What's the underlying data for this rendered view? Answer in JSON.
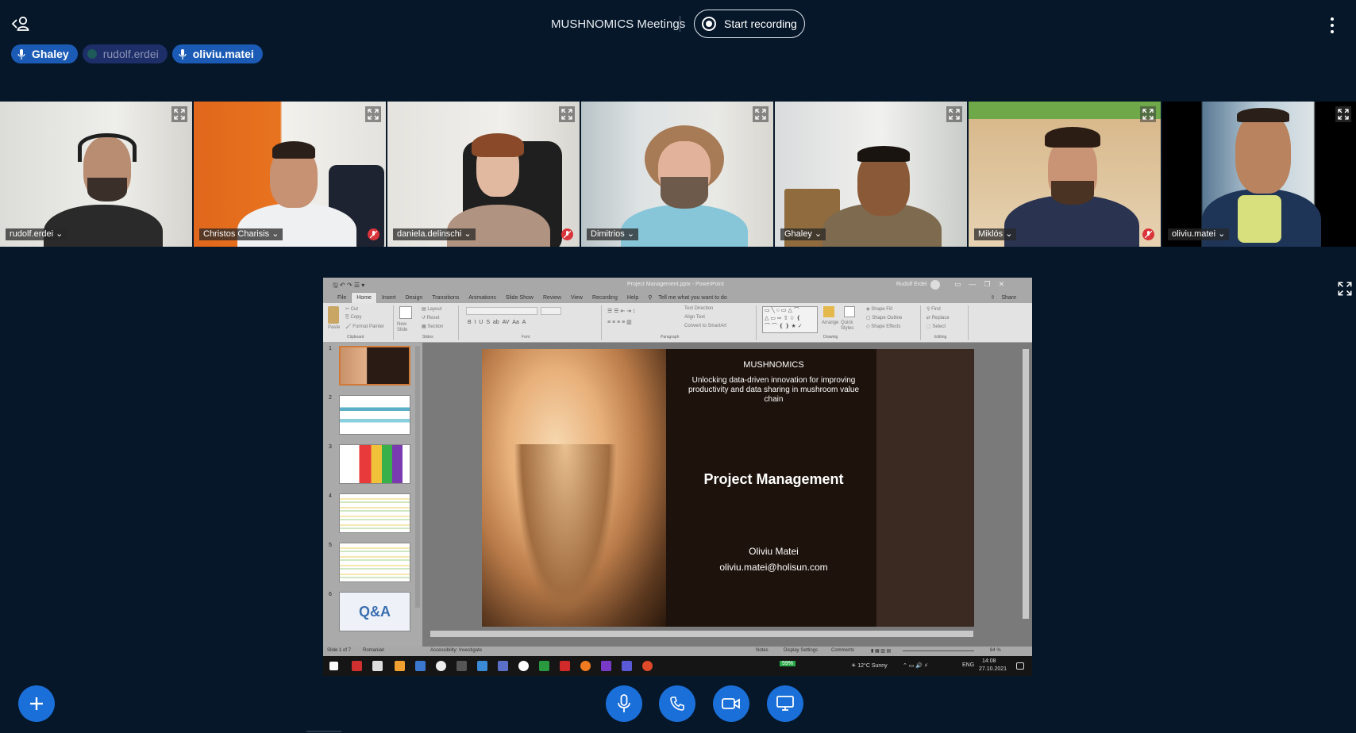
{
  "meeting": {
    "title": "MUSHNOMICS Meetings",
    "record_label": "Start recording"
  },
  "talkers": [
    {
      "name": "Ghaley",
      "state": "talking"
    },
    {
      "name": "rudolf.erdei",
      "state": "muted"
    },
    {
      "name": "oliviu.matei",
      "state": "talking"
    }
  ],
  "participants": [
    {
      "name": "rudolf.erdei",
      "muted": false,
      "speaking": false
    },
    {
      "name": "Christos Charisis",
      "muted": true,
      "speaking": false
    },
    {
      "name": "daniela.delinschi",
      "muted": true,
      "speaking": false
    },
    {
      "name": "Dimitrios",
      "muted": false,
      "speaking": false
    },
    {
      "name": "Ghaley",
      "muted": false,
      "speaking": true
    },
    {
      "name": "Miklós",
      "muted": true,
      "speaking": false
    },
    {
      "name": "oliviu.matei",
      "muted": false,
      "speaking": true
    }
  ],
  "powerpoint": {
    "window_title": "Project Management.pptx - PowerPoint",
    "user": "Rudolf Erdei",
    "tabs": [
      "File",
      "Home",
      "Insert",
      "Design",
      "Transitions",
      "Animations",
      "Slide Show",
      "Review",
      "View",
      "Recording",
      "Help"
    ],
    "active_tab": "Home",
    "tell_me": "Tell me what you want to do",
    "share": "Share",
    "ribbon_groups": [
      "Clipboard",
      "Slides",
      "Font",
      "Paragraph",
      "Drawing",
      "Editing"
    ],
    "ribbon_items": {
      "paste": "Paste",
      "cut": "Cut",
      "copy": "Copy",
      "format_painter": "Format Painter",
      "new_slide": "New Slide",
      "layout": "Layout",
      "reset": "Reset",
      "section": "Section",
      "text_direction": "Text Direction",
      "align_text": "Align Text",
      "convert_smartart": "Convert to SmartArt",
      "arrange": "Arrange",
      "quick_styles": "Quick Styles",
      "shape_fill": "Shape Fill",
      "shape_outline": "Shape Outline",
      "shape_effects": "Shape Effects",
      "find": "Find",
      "replace": "Replace",
      "select": "Select"
    },
    "slide_numbers": [
      "1",
      "2",
      "3",
      "4",
      "5",
      "6"
    ],
    "slide": {
      "brand": "MUSHNOMICS",
      "tagline": "Unlocking data-driven innovation for improving productivity and data sharing in mushroom value chain",
      "title": "Project Management",
      "author": "Oliviu Matei",
      "email": "oliviu.matei@holisun.com"
    },
    "thumb6_text": "Q&A",
    "status": {
      "slide_of": "Slide 1 of 7",
      "language": "Romanian",
      "accessibility": "Accessibility: Investigate",
      "notes": "Notes",
      "display_settings": "Display Settings",
      "comments": "Comments",
      "zoom": "84 %"
    },
    "taskbar": {
      "battery": "59%",
      "weather": "12°C  Sunny",
      "lang": "ENG",
      "time": "14:08",
      "date": "27.10.2021"
    }
  },
  "icons": {
    "user_list": "user-list-icon",
    "record": "record-icon",
    "more": "more-vertical-icon",
    "fullscreen": "fullscreen-icon",
    "actions": "plus-icon",
    "mic": "microphone-icon",
    "phone": "phone-icon",
    "camera": "camera-icon",
    "screenshare": "screen-share-icon"
  },
  "colors": {
    "background": "#06172a",
    "accent": "#1b6fd8",
    "talker_active": "#1b5bb5",
    "talker_muted": "#1d2e68",
    "speaking_outline": "#1b64d2",
    "muted_badge": "#d9343a"
  }
}
